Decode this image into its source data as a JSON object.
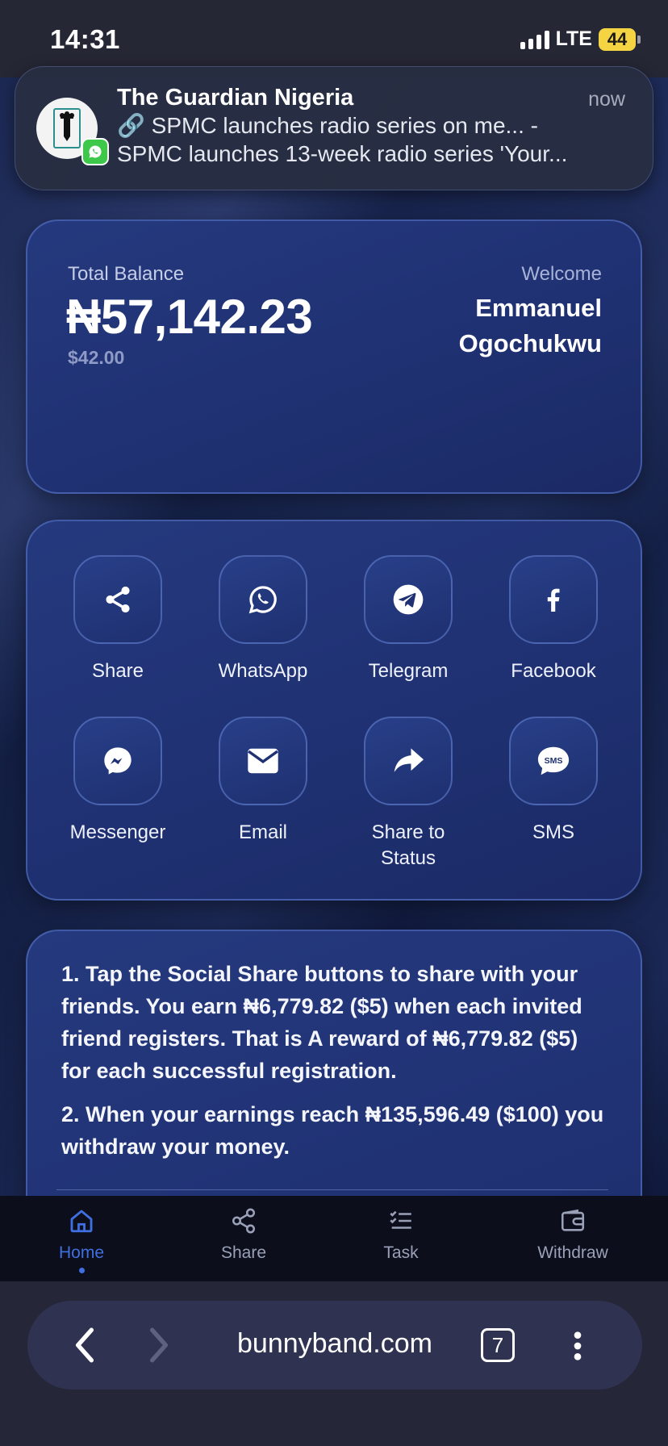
{
  "status_bar": {
    "time": "14:31",
    "network": "LTE",
    "battery": "44"
  },
  "notification": {
    "app": "The Guardian Nigeria",
    "time": "now",
    "line1": "🔗 SPMC launches radio series on me... -",
    "line2": "SPMC launches 13-week radio series 'Your..."
  },
  "balance": {
    "label": "Total Balance",
    "amount": "₦57,142.23",
    "usd": "$42.00",
    "welcome": "Welcome",
    "first_name": "Emmanuel",
    "last_name": "Ogochukwu"
  },
  "share": {
    "items": [
      {
        "label": "Share",
        "icon": "share-nodes-icon"
      },
      {
        "label": "WhatsApp",
        "icon": "whatsapp-icon"
      },
      {
        "label": "Telegram",
        "icon": "telegram-icon"
      },
      {
        "label": "Facebook",
        "icon": "facebook-icon"
      },
      {
        "label": "Messenger",
        "icon": "messenger-icon"
      },
      {
        "label": "Email",
        "icon": "envelope-icon"
      },
      {
        "label": "Share to",
        "label2": "Status",
        "icon": "share-arrow-icon"
      },
      {
        "label": "SMS",
        "icon": "sms-icon",
        "icon_text": "SMS"
      }
    ]
  },
  "info": {
    "p1": "1. Tap the Social Share buttons to share with your friends. You earn ₦6,779.82 ($5) when each invited friend registers. That is A reward of ₦6,779.82 ($5) for each successful registration.",
    "p2": "2. When your earnings reach ₦135,596.49 ($100) you withdraw your money."
  },
  "bottom_nav": {
    "items": [
      {
        "label": "Home",
        "icon": "home-icon",
        "active": true
      },
      {
        "label": "Share",
        "icon": "share-icon"
      },
      {
        "label": "Task",
        "icon": "task-list-icon"
      },
      {
        "label": "Withdraw",
        "icon": "wallet-icon"
      }
    ],
    "accent": "#3f6fe0"
  },
  "browser": {
    "url": "bunnyband.com",
    "tabs": "7"
  }
}
